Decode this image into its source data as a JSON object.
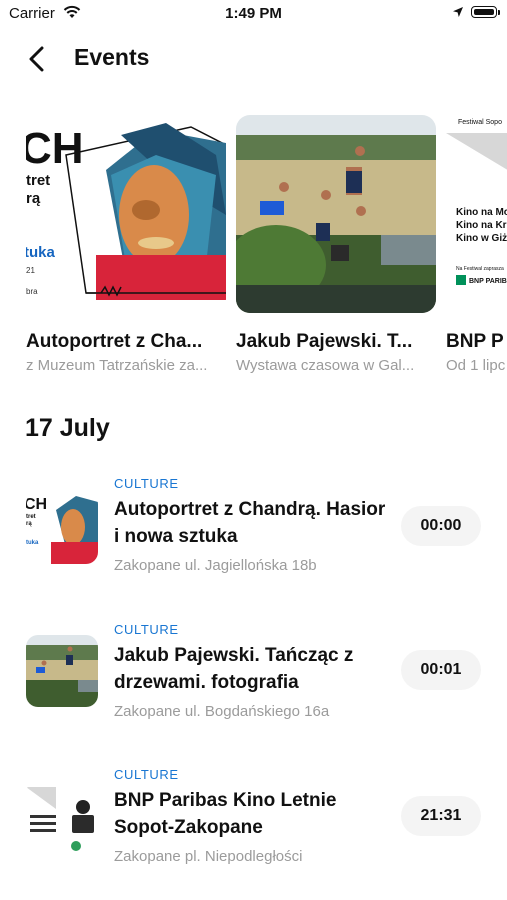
{
  "status_bar": {
    "carrier": "Carrier",
    "time": "1:49 PM"
  },
  "nav": {
    "title": "Events"
  },
  "featured": [
    {
      "title": "Autoportret z Cha...",
      "subtitle": "z Muzeum Tatrzańskie za...",
      "image": "poster-art-icon"
    },
    {
      "title": "Jakub Pajewski. T...",
      "subtitle": "Wystawa czasowa w Gal...",
      "image": "photo-icon"
    },
    {
      "title": "BNP P",
      "subtitle": "Od 1 lipc",
      "image": "poster-icon",
      "poster_text": {
        "top": "Festiwal Sopo",
        "lines": [
          "Kino na Mol",
          "Kino na Krup",
          "Kino w Giży"
        ],
        "small": "Na Festiwal zaprasza",
        "brand": "BNP PARIB"
      }
    }
  ],
  "poster_art": {
    "big": "CH",
    "line1": "tret",
    "line2": "rą",
    "line3": "tuka",
    "line4": "21",
    "line5": "bra"
  },
  "section": {
    "date_heading": "17 July"
  },
  "events": [
    {
      "category": "CULTURE",
      "title": "Autoportret z Chandrą. Hasior i nowa sztuka",
      "location": "Zakopane ul. Jagiellońska 18b",
      "time": "00:00"
    },
    {
      "category": "CULTURE",
      "title": "Jakub Pajewski. Tańcząc z drzewami. fotografia",
      "location": "Zakopane ul. Bogdańskiego 16a",
      "time": "00:01"
    },
    {
      "category": "CULTURE",
      "title": "BNP Paribas Kino Letnie Sopot-Zakopane",
      "location": "Zakopane pl. Niepodległości",
      "time": "21:31"
    }
  ],
  "colors": {
    "accent": "#1976d2",
    "muted": "#9b9b9b",
    "pill": "#f4f4f4"
  }
}
